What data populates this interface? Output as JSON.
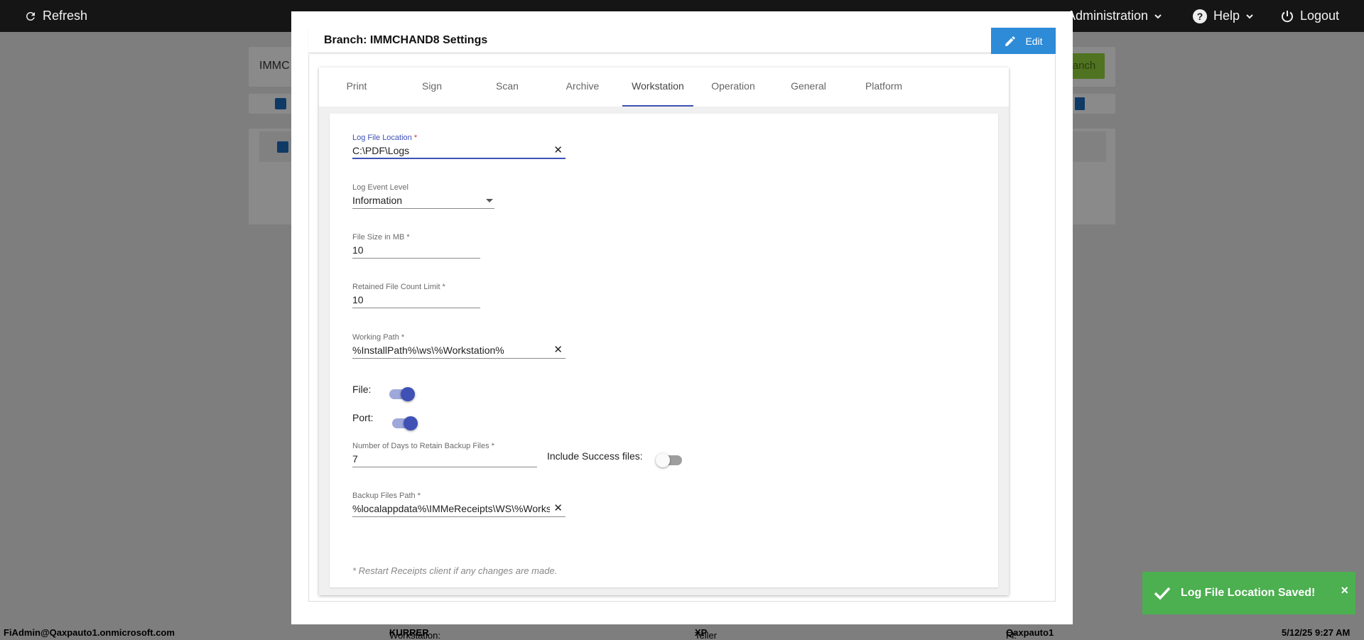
{
  "topbar": {
    "refresh_label": "Refresh",
    "administration_label": "Administration",
    "help_label": "Help",
    "logout_label": "Logout"
  },
  "background": {
    "branch_input_text": "IMMC",
    "add_branch_text": "anch"
  },
  "modal": {
    "title": "Branch: IMMCHAND8 Settings",
    "edit_label": "Edit"
  },
  "tabs": [
    {
      "label": "Print"
    },
    {
      "label": "Sign"
    },
    {
      "label": "Scan"
    },
    {
      "label": "Archive"
    },
    {
      "label": "Workstation",
      "active": true
    },
    {
      "label": "Operation"
    },
    {
      "label": "General"
    },
    {
      "label": "Platform"
    }
  ],
  "form": {
    "log_file_location": {
      "label": "Log File Location",
      "required": "*",
      "value": "C:\\PDF\\Logs"
    },
    "log_event_level": {
      "label": "Log Event Level",
      "value": "Information"
    },
    "file_size": {
      "label": "File Size in MB *",
      "value": "10"
    },
    "retained_count": {
      "label": "Retained File Count Limit *",
      "value": "10"
    },
    "working_path": {
      "label": "Working Path *",
      "value": "%InstallPath%\\ws\\%Workstation%"
    },
    "file_toggle": {
      "label": "File:",
      "on": true
    },
    "port_toggle": {
      "label": "Port:",
      "on": true
    },
    "retain_days": {
      "label": "Number of Days to Retain Backup Files *",
      "value": "7"
    },
    "include_success": {
      "label": "Include Success files:",
      "on": false
    },
    "backup_path": {
      "label": "Backup Files Path *",
      "value": "%localappdata%\\IMMeReceipts\\WS\\%Workstation%"
    },
    "note": "* Restart Receipts client if any changes are made."
  },
  "toast": {
    "message": "Log File Location Saved!",
    "close": "×"
  },
  "footer": {
    "user": "FiAdmin@Qaxpauto1.onmicrosoft.com",
    "workstation_label": "Workstation:",
    "workstation_value": "KURRER",
    "platform_label": "Teller Platform:",
    "platform_value": "XP",
    "fi_label": "FI:",
    "fi_value": "Qaxpauto1",
    "datetime": "5/12/25 9:27 AM"
  },
  "colors": {
    "primary": "#3f51b5",
    "edit_button": "#2e8bd8",
    "toast": "#4caf50",
    "topbar": "#151515"
  }
}
